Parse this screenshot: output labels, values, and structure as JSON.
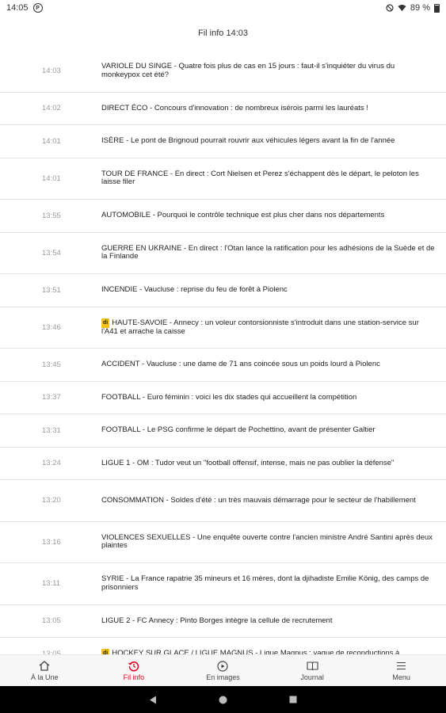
{
  "status_bar": {
    "time": "14:05",
    "battery": "89 %"
  },
  "header": {
    "title": "Fil info 14:03"
  },
  "feed": [
    {
      "time": "14:03",
      "text": "VARIOLE DU SINGE - Quatre fois plus de cas en 15 jours : faut-il s'inquiéter du virus du monkeypox cet été?",
      "badge": ""
    },
    {
      "time": "14:02",
      "text": "DIRECT ÉCO  - Concours d'innovation : de nombreux isérois parmi les lauréats !",
      "badge": ""
    },
    {
      "time": "14:01",
      "text": "ISÈRE - Le pont de Brignoud pourrait rouvrir aux véhicules légers avant la fin de l'année",
      "badge": ""
    },
    {
      "time": "14:01",
      "text": "TOUR DE FRANCE - En direct : Cort Nielsen et Perez s'échappent dès le départ, le peloton les laisse filer",
      "badge": ""
    },
    {
      "time": "13:55",
      "text": "AUTOMOBILE - Pourquoi le contrôle technique est plus cher dans nos départements",
      "badge": ""
    },
    {
      "time": "13:54",
      "text": "GUERRE EN UKRAINE - En direct : l'Otan lance la ratification pour les adhésions de la Suède et de la Finlande",
      "badge": ""
    },
    {
      "time": "13:51",
      "text": "INCENDIE - Vaucluse : reprise du feu de forêt à Piolenc",
      "badge": ""
    },
    {
      "time": "13:46",
      "text": "HAUTE-SAVOIE - Annecy : un voleur contorsionniste s'introduit dans une station-service sur l'A41 et arrache la caisse",
      "badge": "di"
    },
    {
      "time": "13:45",
      "text": "ACCIDENT - Vaucluse : une dame de 71 ans coincée sous un poids lourd à Piolenc",
      "badge": ""
    },
    {
      "time": "13:37",
      "text": "FOOTBALL - Euro féminin : voici les dix stades qui accueillent la compétition",
      "badge": ""
    },
    {
      "time": "13:31",
      "text": "FOOTBALL - Le PSG confirme le départ de Pochettino, avant de présenter Galtier",
      "badge": ""
    },
    {
      "time": "13:24",
      "text": "LIGUE 1 - OM : Tudor veut un \"football offensif, intense, mais ne pas oublier la défense\"",
      "badge": ""
    },
    {
      "time": "13:20",
      "text": "CONSOMMATION - Soldes d'été : un très mauvais démarrage pour le secteur de l'habillement",
      "badge": ""
    },
    {
      "time": "13:16",
      "text": "VIOLENCES SEXUELLES - Une enquête ouverte contre l'ancien ministre André Santini après deux plaintes",
      "badge": ""
    },
    {
      "time": "13:11",
      "text": "SYRIE - La France rapatrie 35 mineurs et 16 mères, dont la djihadiste Emilie König, des camps de prisonniers",
      "badge": ""
    },
    {
      "time": "13:05",
      "text": "LIGUE 2 - FC Annecy : Pinto Borges intègre la cellule de recrutement",
      "badge": ""
    },
    {
      "time": "13:05",
      "text": "HOCKEY SUR GLACE / LIGUE MAGNUS - Ligue Magnus : vague de reconductions à",
      "badge": "di"
    }
  ],
  "bottom_nav": [
    {
      "label": "À la Une",
      "icon": "home-icon",
      "active": false
    },
    {
      "label": "Fil info",
      "icon": "clock-history-icon",
      "active": true
    },
    {
      "label": "En images",
      "icon": "play-circle-icon",
      "active": false
    },
    {
      "label": "Journal",
      "icon": "newspaper-icon",
      "active": false
    },
    {
      "label": "Menu",
      "icon": "hamburger-menu-icon",
      "active": false
    }
  ],
  "colors": {
    "accent": "#e1001a",
    "badge": "#f3c21b",
    "time_text": "#9a9a9a",
    "divider": "#e4e4e4"
  }
}
